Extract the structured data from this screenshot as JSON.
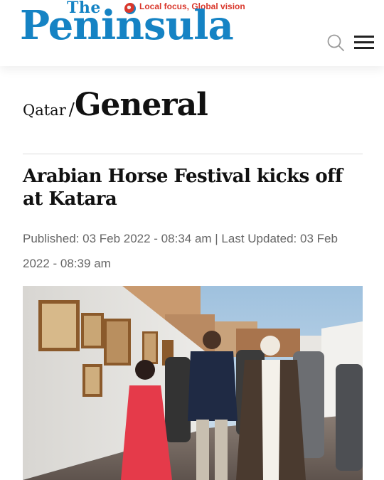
{
  "header": {
    "logo_the": "The",
    "logo_name": "Peninsula",
    "logo_tagline": "Local focus, Global vision",
    "icons": {
      "search": "search-icon",
      "menu": "hamburger-menu-icon"
    },
    "colors": {
      "brand_blue": "#1583c4",
      "tagline_red": "#d9372b"
    }
  },
  "section": {
    "parent": "Qatar",
    "separator": "/",
    "current": "General"
  },
  "article": {
    "headline": "Arabian Horse Festival kicks off at Katara",
    "published": "Published: 03 Feb 2022 - 08:34 am | Last Updated: 03 Feb 2022 - 08:39 am"
  }
}
